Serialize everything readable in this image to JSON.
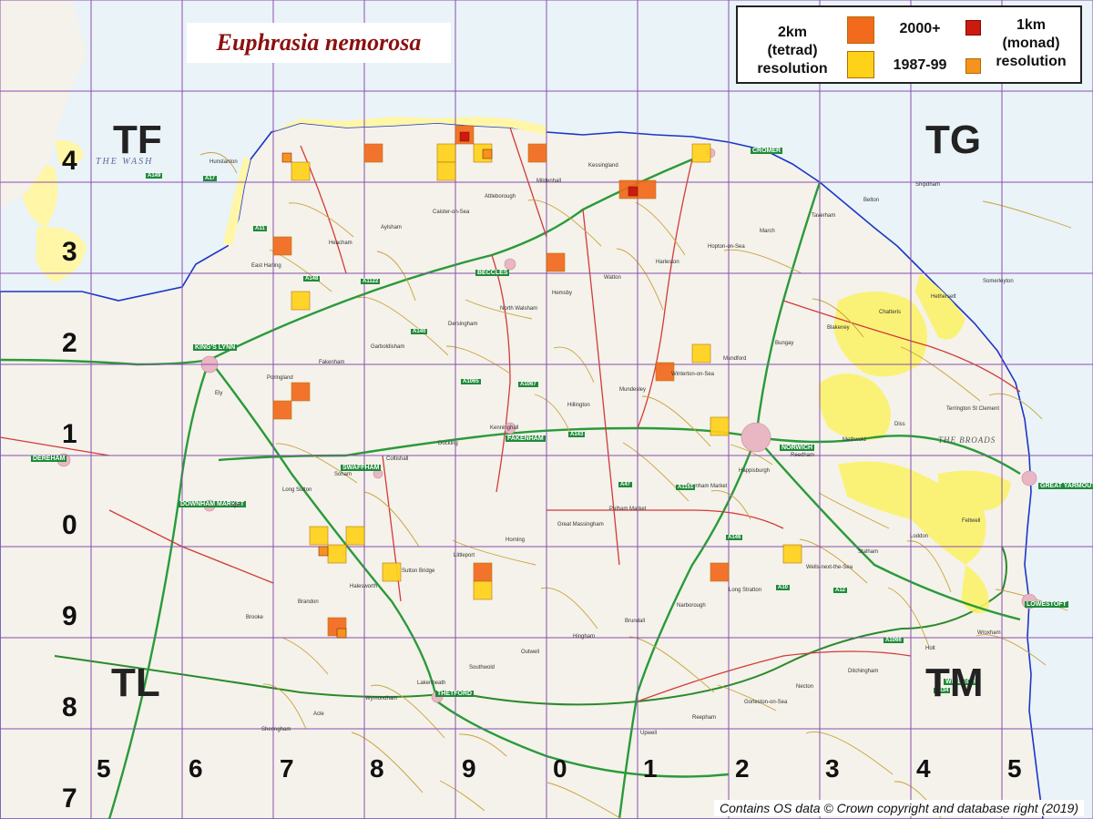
{
  "map": {
    "title": "Euphrasia nemorosa",
    "attribution": "Contains OS data © Crown copyright and database right (2019)",
    "colors": {
      "sea": "#eaf3f8",
      "land": "#f4f2ea",
      "sand": "#fff6a8",
      "grid_line": "#8a4fb0",
      "coast": "#1c36c8",
      "road_primary": "#2a9a3a",
      "road_a": "#d23a3a",
      "road_b": "#c9a23a",
      "broads": "#fbf26a",
      "tetrad_2000_plus": "#f26a1c",
      "tetrad_1987_99": "#ffd21a",
      "monad_2000_plus": "#cc1a0e",
      "monad_1987_99": "#f5931e"
    },
    "grid_square_labels": [
      "TF",
      "TG",
      "TL",
      "TM"
    ],
    "northing_labels": [
      "4",
      "3",
      "2",
      "1",
      "0",
      "9",
      "8",
      "7"
    ],
    "easting_labels": [
      "5",
      "6",
      "7",
      "8",
      "9",
      "0",
      "1",
      "2",
      "3",
      "4",
      "5"
    ],
    "water_labels": [
      "THE WASH",
      "THE BROADS"
    ],
    "town_labels": [
      "KING'S LYNN",
      "NORWICH",
      "GREAT YARMOUTH",
      "LOWESTOFT",
      "CROMER",
      "THETFORD",
      "DOWNHAM MARKET",
      "SWAFFHAM",
      "BECCLES",
      "FAKENHAM",
      "DEREHAM",
      "WISBECH"
    ],
    "place_labels": [
      "Hunstanton",
      "Heacham",
      "Dersingham",
      "Hillington",
      "Burnham Market",
      "Wells-next-the-Sea",
      "Holt",
      "Sheringham",
      "Aylsham",
      "North Walsham",
      "Mundesley",
      "Happisburgh",
      "Stalham",
      "Wroxham",
      "Acle",
      "Caister-on-Sea",
      "Hemsby",
      "Winterton-on-Sea",
      "Reedham",
      "Loddon",
      "Brooke",
      "Wymondham",
      "Attleborough",
      "Watton",
      "Mundford",
      "Methwold",
      "Feltwell",
      "Brandon",
      "Lakenheath",
      "Mildenhall",
      "Harleston",
      "Bungay",
      "Diss",
      "Eye",
      "Halesworth",
      "Southwold",
      "Kessingland",
      "Hopton-on-Sea",
      "Blakeney",
      "Terrington St Clement",
      "Long Sutton",
      "Sutton Bridge",
      "Outwell",
      "Upwell",
      "March",
      "Chatteris",
      "Ely",
      "Soham",
      "Littleport",
      "Hingham",
      "Reepham",
      "Taverham",
      "Hethersett",
      "Poringland",
      "Coltishall",
      "Horning",
      "Brundall",
      "Gorleston-on-Sea",
      "Belton",
      "Somerleyton",
      "Fakenham",
      "Docking",
      "Great Massingham",
      "Narborough",
      "Necton",
      "Shipdham",
      "East Harling",
      "Garboldisham",
      "Kenninghall",
      "Pulham Market",
      "Long Stratton",
      "Ditchingham"
    ],
    "road_labels": [
      "A149",
      "A148",
      "A1065",
      "A47",
      "A10",
      "A134",
      "A11",
      "A140",
      "A143",
      "A146",
      "A1066",
      "A17",
      "A1122",
      "A1067",
      "A1151",
      "A12"
    ],
    "legend": {
      "tetrad_label": "2km\n(tetrad)\nresolution",
      "monad_label": "1km\n(monad)\nresolution",
      "period_recent": "2000+",
      "period_old": "1987-99"
    },
    "records": {
      "tetrads": [
        {
          "period": "2000+",
          "e": "TF8",
          "n": "4"
        },
        {
          "period": "1987-99",
          "e": "TF7",
          "n": "4"
        },
        {
          "period": "2000+",
          "e": "TF7",
          "n": "3"
        },
        {
          "period": "1987-99",
          "e": "TF7",
          "n": "2"
        },
        {
          "period": "2000+",
          "e": "TF7",
          "n": "1"
        },
        {
          "period": "2000+",
          "e": "TF7",
          "n": "1"
        },
        {
          "period": "1987-99",
          "e": "TF8",
          "n": "4"
        },
        {
          "period": "1987-99",
          "e": "TF8",
          "n": "4"
        },
        {
          "period": "2000+",
          "e": "TF9",
          "n": "4"
        },
        {
          "period": "1987-99",
          "e": "TF9",
          "n": "4"
        },
        {
          "period": "2000+",
          "e": "TF9",
          "n": "4"
        },
        {
          "period": "2000+",
          "e": "TF9",
          "n": "3"
        },
        {
          "period": "2000+",
          "e": "TG0",
          "n": "4"
        },
        {
          "period": "2000+",
          "e": "TG0",
          "n": "4"
        },
        {
          "period": "1987-99",
          "e": "TG1",
          "n": "4"
        },
        {
          "period": "1987-99",
          "e": "TG1",
          "n": "2"
        },
        {
          "period": "2000+",
          "e": "TG1",
          "n": "2"
        },
        {
          "period": "1987-99",
          "e": "TG1",
          "n": "1"
        },
        {
          "period": "1987-99",
          "e": "TF8",
          "n": "0"
        },
        {
          "period": "1987-99",
          "e": "TF8",
          "n": "0"
        },
        {
          "period": "1987-99",
          "e": "TF8",
          "n": "9"
        },
        {
          "period": "1987-99",
          "e": "TF9",
          "n": "9"
        },
        {
          "period": "2000+",
          "e": "TF9",
          "n": "9"
        },
        {
          "period": "1987-99",
          "e": "TF9",
          "n": "9"
        },
        {
          "period": "2000+",
          "e": "TL8",
          "n": "8"
        },
        {
          "period": "2000+",
          "e": "TG1",
          "n": "9"
        },
        {
          "period": "1987-99",
          "e": "TG2",
          "n": "9"
        }
      ],
      "monads": [
        {
          "period": "2000+",
          "e": "TF9",
          "n": "4"
        },
        {
          "period": "1987-99",
          "e": "TF9",
          "n": "4"
        },
        {
          "period": "1987-99",
          "e": "TF8",
          "n": "4"
        },
        {
          "period": "2000+",
          "e": "TG1",
          "n": "3"
        },
        {
          "period": "1987-99",
          "e": "TL8",
          "n": "8"
        },
        {
          "period": "1987-99",
          "e": "TF8",
          "n": "0"
        }
      ]
    }
  }
}
